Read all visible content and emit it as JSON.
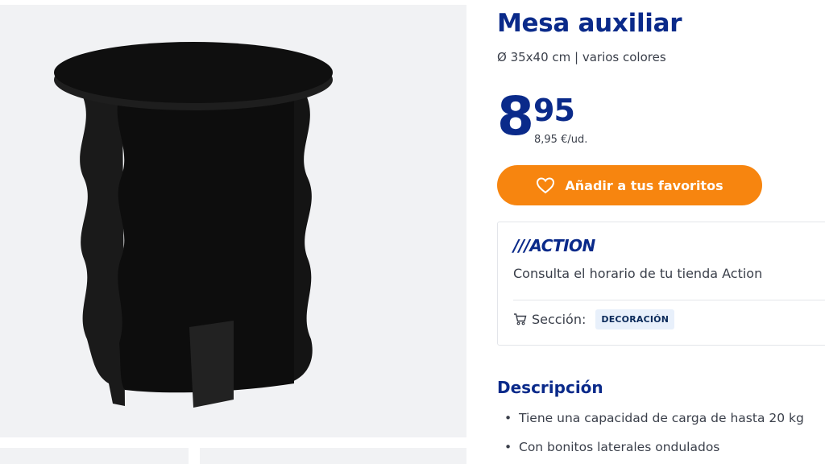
{
  "product": {
    "title": "Mesa auxiliar",
    "subtitle": "Ø 35x40 cm | varios colores",
    "price": {
      "integer": "8",
      "decimals": "95",
      "unit_price": "8,95 €/ud."
    },
    "image_alt": "black side table with wavy legs"
  },
  "favorites_button": {
    "label": "Añadir a tus favoritos",
    "icon": "heart-icon"
  },
  "store": {
    "logo_text": "///ACTION",
    "hours_text": "Consulta el horario de tu tienda Action",
    "section_label": "Sección:",
    "section_badge": "DECORACIÓN",
    "section_icon": "cart-icon"
  },
  "description": {
    "title": "Descripción",
    "items": [
      "Tiene una capacidad de carga de hasta 20 kg",
      "Con bonitos laterales ondulados"
    ]
  },
  "colors": {
    "brand_blue": "#0a2a8a",
    "accent_orange": "#f7850f",
    "gallery_bg": "#f1f2f4"
  }
}
